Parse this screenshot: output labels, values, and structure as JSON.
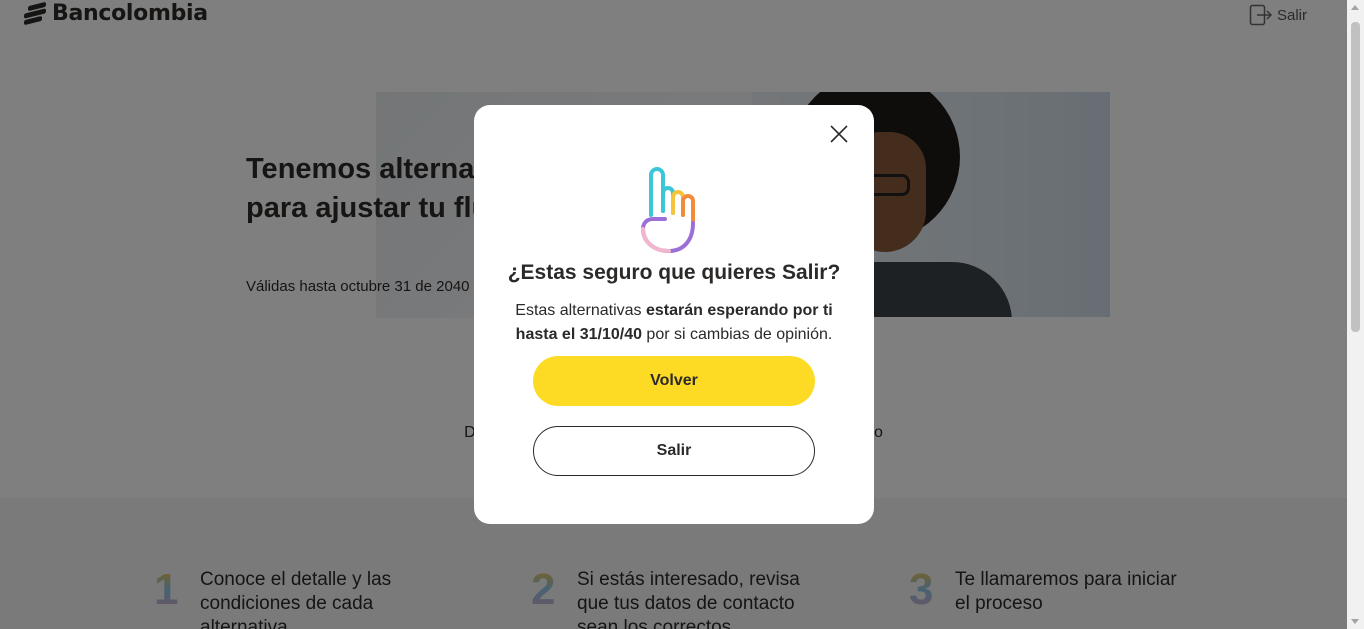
{
  "header": {
    "brand_name": "Bancolombia",
    "logout_label": "Salir"
  },
  "hero": {
    "title": "Tenemos alternativas diponibles para ajustar tu flujo de caja.",
    "subtitle": "Válidas hasta octubre 31 de 2040",
    "discover_text": "Descubre cómo reducir tu cuota mensual si amplia el plazo"
  },
  "steps": [
    {
      "number": "1",
      "text": "Conoce el detalle y las condiciones de cada alternativa"
    },
    {
      "number": "2",
      "text": "Si estás interesado, revisa que tus datos de contacto sean los correctos"
    },
    {
      "number": "3",
      "text": "Te llamaremos para iniciar el proceso"
    }
  ],
  "modal": {
    "title": "¿Estas seguro que quieres Salir?",
    "body_part1": "Estas alternativas ",
    "body_bold": "estarán esperando por ti hasta el 31/10/40",
    "body_part2": " por si cambias de opinión.",
    "primary_label": "Volver",
    "secondary_label": "Salir"
  },
  "colors": {
    "accent_yellow": "#fdda24",
    "text_dark": "#2c2a29",
    "overlay": "rgba(0,0,0,0.5)"
  },
  "icons": {
    "close": "close-icon",
    "hand": "hand-pointing-up-icon",
    "logout": "logout-icon"
  }
}
